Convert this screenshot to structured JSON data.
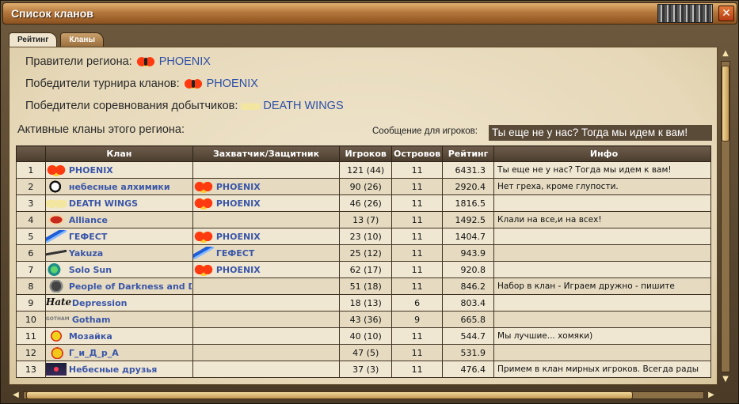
{
  "window": {
    "title": "Список кланов"
  },
  "tabs": [
    {
      "label": "Рейтинг",
      "active": true
    },
    {
      "label": "Кланы",
      "active": false
    }
  ],
  "summary": {
    "rulers_label": "Правители региона:",
    "rulers_clan": "PHOENIX",
    "tournament_label": "Победители турнира кланов:",
    "tournament_clan": "PHOENIX",
    "miners_label": "Победители соревнования добытчиков:",
    "miners_clan": "DEATH WINGS"
  },
  "active_title": "Активные кланы этого региона:",
  "message": {
    "label": "Сообщение для игроков:",
    "text": "Ты еще не у нас? Тогда мы идем к вам!"
  },
  "table": {
    "headers": [
      "",
      "Клан",
      "Захватчик/Защитник",
      "Игроков",
      "Островов",
      "Рейтинг",
      "Инфо"
    ],
    "rows": [
      {
        "num": "1",
        "icon": "phoenix-icon",
        "clan": "PHOENIX",
        "cap_icon": "",
        "captor": "",
        "players": "121 (44)",
        "islands": "11",
        "rating": "6431.3",
        "info": "Ты еще не у нас? Тогда мы идем к вам!"
      },
      {
        "num": "2",
        "icon": "skull-icon",
        "clan": "небесные алхимики",
        "cap_icon": "phoenix-icon",
        "captor": "PHOENIX",
        "players": "90 (26)",
        "islands": "11",
        "rating": "2920.4",
        "info": "Нет греха, кроме глупости."
      },
      {
        "num": "3",
        "icon": "wings-icon",
        "clan": "DEATH WINGS",
        "cap_icon": "phoenix-icon",
        "captor": "PHOENIX",
        "players": "46 (26)",
        "islands": "11",
        "rating": "1816.5",
        "info": ""
      },
      {
        "num": "4",
        "icon": "alliance-icon",
        "clan": "Alliance",
        "cap_icon": "",
        "captor": "",
        "players": "13 (7)",
        "islands": "11",
        "rating": "1492.5",
        "info": "Клали на все,и на всех!"
      },
      {
        "num": "5",
        "icon": "lightning-icon",
        "clan": "ГЕФЕСТ",
        "cap_icon": "phoenix-icon",
        "captor": "PHOENIX",
        "players": "23 (10)",
        "islands": "11",
        "rating": "1404.7",
        "info": ""
      },
      {
        "num": "6",
        "icon": "yakuza-icon",
        "clan": "Yakuza",
        "cap_icon": "lightning-icon",
        "captor": "ГЕФЕСТ",
        "players": "25 (12)",
        "islands": "11",
        "rating": "943.9",
        "info": ""
      },
      {
        "num": "7",
        "icon": "sun-icon",
        "clan": "Solo Sun",
        "cap_icon": "phoenix-icon",
        "captor": "PHOENIX",
        "players": "62 (17)",
        "islands": "11",
        "rating": "920.8",
        "info": ""
      },
      {
        "num": "8",
        "icon": "dark-icon",
        "clan": "People of Darkness and D",
        "cap_icon": "",
        "captor": "",
        "players": "51 (18)",
        "islands": "11",
        "rating": "846.2",
        "info": "Набор в клан - Играем дружно - пишите"
      },
      {
        "num": "9",
        "icon": "hate-icon",
        "clan": "Depression",
        "cap_icon": "",
        "captor": "",
        "players": "18 (13)",
        "islands": "6",
        "rating": "803.4",
        "info": ""
      },
      {
        "num": "10",
        "icon": "gotham-icon",
        "clan": "Gotham",
        "cap_icon": "",
        "captor": "",
        "players": "43 (36)",
        "islands": "9",
        "rating": "665.8",
        "info": ""
      },
      {
        "num": "11",
        "icon": "mosaic-icon",
        "clan": "Мозайка",
        "cap_icon": "",
        "captor": "",
        "players": "40 (10)",
        "islands": "11",
        "rating": "544.7",
        "info": "Мы лучшие... хомяки)"
      },
      {
        "num": "12",
        "icon": "gidra-icon",
        "clan": "Г_и_Д_р_А",
        "cap_icon": "",
        "captor": "",
        "players": "47 (5)",
        "islands": "11",
        "rating": "531.9",
        "info": ""
      },
      {
        "num": "13",
        "icon": "friends-icon",
        "clan": "Небесные друзья",
        "cap_icon": "",
        "captor": "",
        "players": "37 (3)",
        "islands": "11",
        "rating": "476.4",
        "info": "Примем в клан мирных игроков. Всегда рады"
      }
    ]
  },
  "icon_text": {
    "hate": "Hate",
    "gotham": "GOTHAM"
  },
  "glyphs": {
    "close": "✕",
    "up": "▲",
    "down": "▼",
    "left": "◀",
    "right": "▶"
  }
}
